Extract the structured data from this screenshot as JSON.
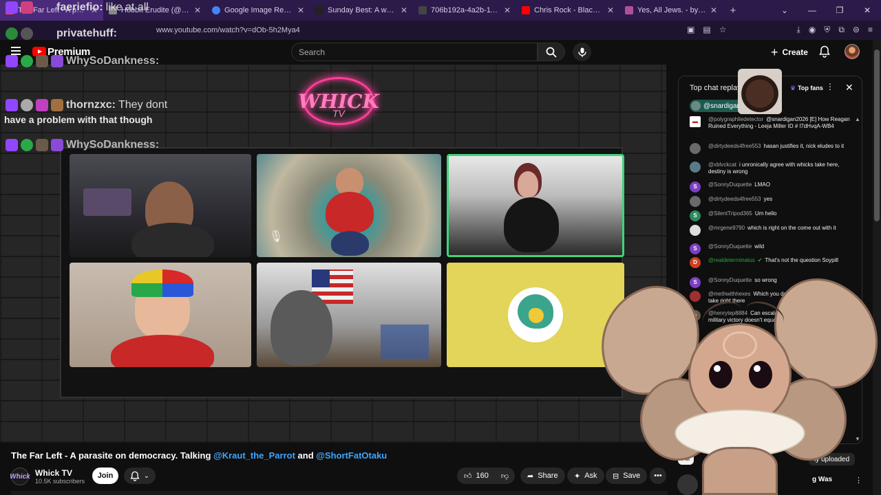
{
  "browser": {
    "tabs": [
      {
        "title": "The Far Left - A parasite on de",
        "active": true,
        "color": "#ff4040"
      },
      {
        "title": "Hobbit Erudite (@HobbitErudite) /",
        "active": false,
        "color": "#888888"
      },
      {
        "title": "Google Image Result",
        "active": false,
        "color": "#4285f4"
      },
      {
        "title": "Sunday Best: A well-dressed cat",
        "active": false,
        "color": "#222222"
      },
      {
        "title": "706b192a-4a2b-11e7-8e03-0ed6ca",
        "active": false,
        "color": "#444444"
      },
      {
        "title": "Chris Rock - Black People VS. N",
        "active": false,
        "color": "#ff0000"
      },
      {
        "title": "Yes, All Jews. - by Amanda Gele",
        "active": false,
        "color": "#b04fa0"
      }
    ],
    "url": "www.youtube.com/watch?v=dOb-5h2Mya4"
  },
  "youtube": {
    "brand": "Premium",
    "search_placeholder": "Search",
    "create_label": "Create"
  },
  "video": {
    "logo_text": "WHICK",
    "logo_sub": "TV"
  },
  "overlay_chat": [
    {
      "user": "faeriefio:",
      "text": "like at all"
    },
    {
      "user": "privatehuff:",
      "text": ""
    },
    {
      "user": "WhySoDankness:",
      "text": ""
    },
    {
      "user": "thornzxc:",
      "text": "They dont"
    },
    {
      "user": "",
      "text": "have a problem with that though"
    },
    {
      "user": "WhySoDankness:",
      "text": ""
    }
  ],
  "meta": {
    "title_prefix": "The Far Left - A parasite on democracy. Talking",
    "mention1": "@Kraut_the_Parrot",
    "and": "and",
    "mention2": "@ShortFatOtaku",
    "channel": "Whick TV",
    "subscribers": "10.5K subscribers",
    "join": "Join",
    "likes": "160",
    "share": "Share",
    "ask": "Ask",
    "save": "Save",
    "channel_logo": "Whick"
  },
  "chat_panel": {
    "title": "Top chat replay",
    "top_fans": "Top fans",
    "pinned_user": "@snardigan",
    "messages": [
      {
        "user": "@polygraphliedetector",
        "text": "@snardigan2026 [E] How Reagan Ruined Everything - Leeja Miller ID # l7dHvqA-WB4",
        "av": "",
        "color": "#ffffff",
        "mod": false
      },
      {
        "user": "@dirtydeeds4free553",
        "text": "hasan justifies it, nick eludes to it",
        "av": "",
        "color": "#6a6a6a",
        "mod": false
      },
      {
        "user": "@xblvckcat",
        "text": "i unronically agree with whicks take here, destiny is wrong",
        "av": "",
        "color": "#5a7a8a",
        "mod": false
      },
      {
        "user": "@SonnyDuquette",
        "text": "LMAO",
        "av": "S",
        "color": "#7b3fc4",
        "mod": false
      },
      {
        "user": "@dirtydeeds4free553",
        "text": "yes",
        "av": "",
        "color": "#6a6a6a",
        "mod": false
      },
      {
        "user": "@SilentTripod365",
        "text": "Um hello",
        "av": "S",
        "color": "#2b8a5a",
        "mod": false
      },
      {
        "user": "@mrgene9790",
        "text": "which is right on the come out with it",
        "av": "",
        "color": "#dddddd",
        "mod": false
      },
      {
        "user": "@SonnyDuquette",
        "text": "wild",
        "av": "S",
        "color": "#7b3fc4",
        "mod": false
      },
      {
        "user": "@realdeterminatus",
        "text": "That's not the question Soypill",
        "av": "D",
        "color": "#d04020",
        "mod": true
      },
      {
        "user": "@SonnyDuquette",
        "text": "so wrong",
        "av": "S",
        "color": "#7b3fc4",
        "mod": false
      },
      {
        "user": "@methwithhexes",
        "text": "Which you do not believe that, insane take right there",
        "av": "",
        "color": "#a03030",
        "mod": false
      },
      {
        "user": "@henrytep8884",
        "text": "Can escalate into a quagmire because military victory doesn't equate to strategic goals",
        "av": "h",
        "color": "#6a5a4a",
        "mod": false
      }
    ]
  },
  "right_column": {
    "chip_all": "All",
    "uploaded": "ly uploaded",
    "rec_title": "g Was"
  }
}
